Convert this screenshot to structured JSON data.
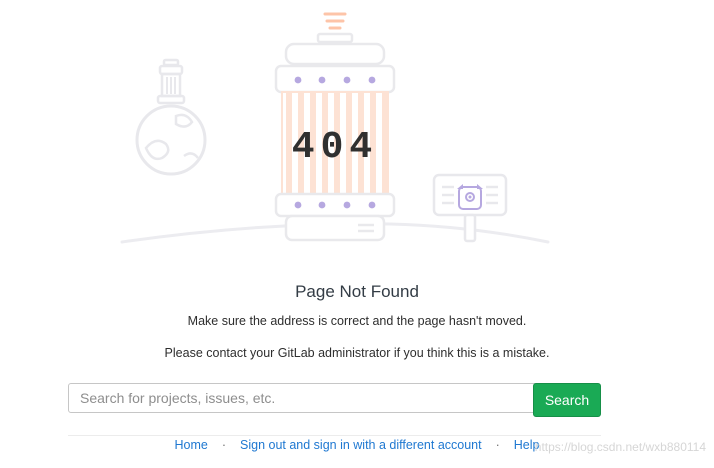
{
  "error": {
    "code": "404",
    "title": "Page Not Found",
    "message_1": "Make sure the address is correct and the page hasn't moved.",
    "message_2": "Please contact your GitLab administrator if you think this is a mistake."
  },
  "search": {
    "placeholder": "Search for projects, issues, etc.",
    "value": "",
    "button_label": "Search"
  },
  "footer": {
    "links": [
      "Home",
      "Sign out and sign in with a different account",
      "Help"
    ],
    "separator": "·"
  },
  "watermark": "https://blog.csdn.net/wxb880114",
  "colors": {
    "accent": "#1aaa55",
    "link": "#1f78d1",
    "illustration_purple": "#b6a8e0",
    "illustration_orange": "#fdc4a8",
    "illustration_stroke": "#e9e9ec"
  }
}
